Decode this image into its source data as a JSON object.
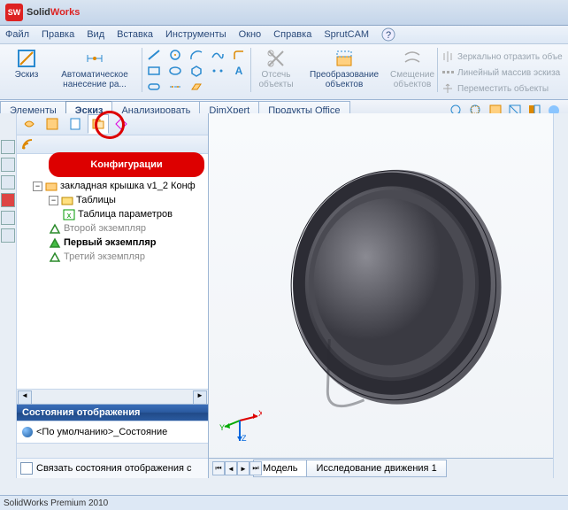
{
  "title": {
    "solid": "Solid",
    "works": "Works"
  },
  "menu": [
    "Файл",
    "Правка",
    "Вид",
    "Вставка",
    "Инструменты",
    "Окно",
    "Справка",
    "SprutCAM"
  ],
  "ribbon": {
    "sketch_btn": "Эскиз",
    "auto_btn": "Автоматическое\nнанесение ра...",
    "trim_btn": "Отсечь\nобъекты",
    "convert_btn": "Преобразование\nобъектов",
    "offset_btn": "Смещение\nобъектов",
    "mirror": "Зеркально отразить объе",
    "array": "Линейный массив эскиза",
    "move": "Переместить объекты"
  },
  "tabs": [
    "Элементы",
    "Эскиз",
    "Анализировать",
    "DimXpert",
    "Продукты Office"
  ],
  "active_tab": "Эскиз",
  "panel": {
    "config_label": "Kонфигурации",
    "root": "закладная крышка v1_2 Конф",
    "tables": "Таблицы",
    "param_table": "Таблица параметров",
    "inst2": "Второй экземпляр",
    "inst1": "Первый экземпляр",
    "inst3": "Третий экземпляр",
    "disp_header": "Состояния отображения",
    "disp_default": "<По умолчанию>_Состояние",
    "link_chk": "Связать состояния отображения с"
  },
  "viewport": {
    "tabs": [
      "Модель",
      "Исследование движения 1"
    ],
    "active_tab": "Модель"
  },
  "status": "SolidWorks Premium 2010"
}
